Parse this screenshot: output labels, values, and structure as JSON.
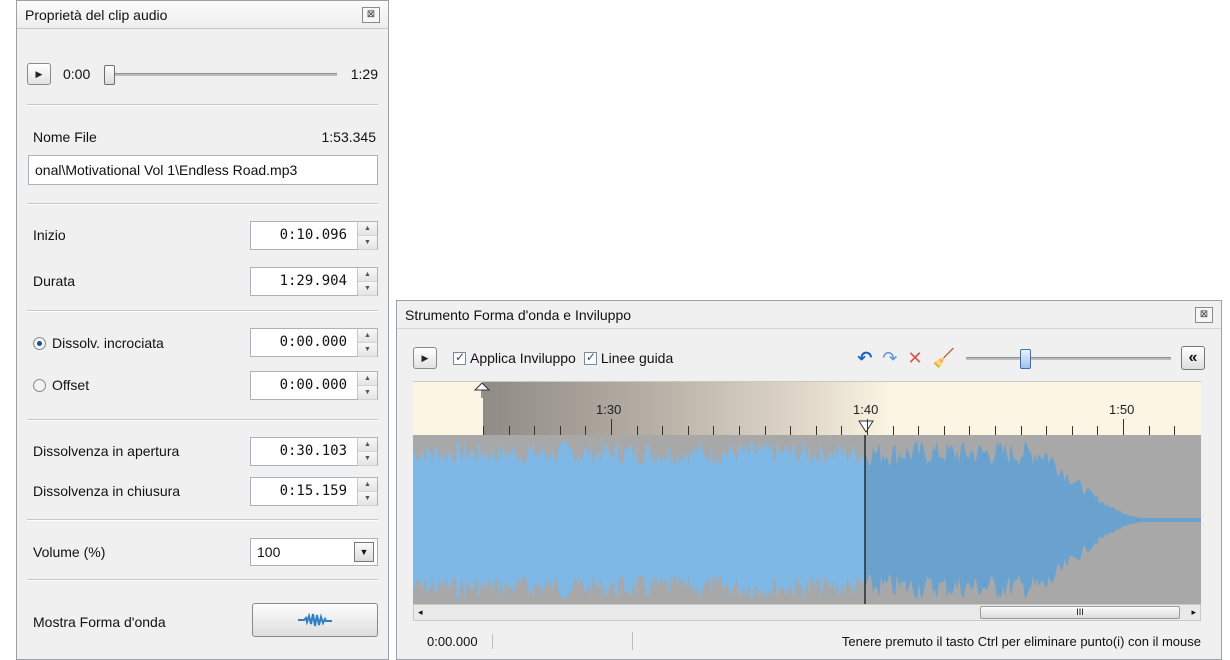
{
  "clip_panel": {
    "title": "Proprietà del clip audio",
    "close_glyph": "⊠",
    "player": {
      "current": "0:00",
      "total": "1:29",
      "position": 0.0
    },
    "file": {
      "label": "Nome File",
      "duration": "1:53.345",
      "path": "onal\\Motivational Vol 1\\Endless Road.mp3"
    },
    "start": {
      "label": "Inizio",
      "value": "0:10.096"
    },
    "duration": {
      "label": "Durata",
      "value": "1:29.904"
    },
    "crossfade": {
      "label": "Dissolv. incrociata",
      "value": "0:00.000",
      "selected": true
    },
    "offset": {
      "label": "Offset",
      "value": "0:00.000",
      "selected": false
    },
    "fade_in": {
      "label": "Dissolvenza in apertura",
      "value": "0:30.103"
    },
    "fade_out": {
      "label": "Dissolvenza in chiusura",
      "value": "0:15.159"
    },
    "volume": {
      "label": "Volume (%)",
      "value": "100"
    },
    "waveform": {
      "label": "Mostra Forma d'onda"
    }
  },
  "wave_panel": {
    "title": "Strumento Forma d'onda e Inviluppo",
    "close_glyph": "⊠",
    "apply_envelope": {
      "label": "Applica Inviluppo",
      "checked": true
    },
    "guide_lines": {
      "label": "Linee guida",
      "checked": true
    },
    "collapse_glyph": "«",
    "zoom_level": 0.28,
    "ruler_labels": [
      "1:30",
      "1:40",
      "1:50"
    ],
    "status": {
      "time": "0:00.000",
      "hint": "Tenere premuto il tasto Ctrl per eliminare punto(i) con il mouse"
    },
    "scroll_glyph": "III"
  },
  "colors": {
    "wave_fill": "#7db8e6",
    "wave_fade": "#6aa2cf",
    "background_dim": "#a8a8a8"
  }
}
